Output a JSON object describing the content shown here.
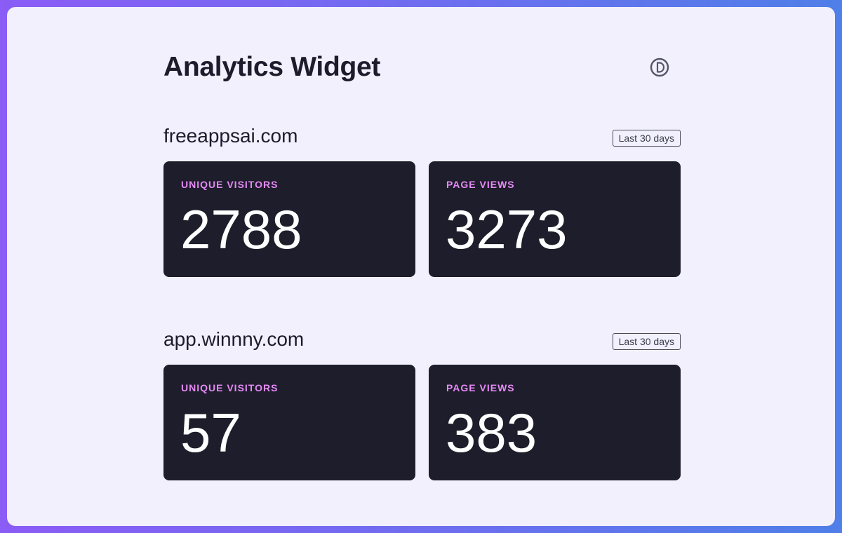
{
  "header": {
    "title": "Analytics Widget",
    "theme_toggle_icon": "contrast-toggle-icon"
  },
  "sites": [
    {
      "domain": "freeappsai.com",
      "range": "Last 30 days",
      "metrics": [
        {
          "label": "UNIQUE VISITORS",
          "value": "2788"
        },
        {
          "label": "PAGE VIEWS",
          "value": "3273"
        }
      ]
    },
    {
      "domain": "app.winnny.com",
      "range": "Last 30 days",
      "metrics": [
        {
          "label": "UNIQUE VISITORS",
          "value": "57"
        },
        {
          "label": "PAGE VIEWS",
          "value": "383"
        }
      ]
    }
  ],
  "colors": {
    "background_gradient_start": "#8b5cf6",
    "background_gradient_end": "#4f7fe8",
    "panel": "#f1f0fc",
    "card": "#1e1d2b",
    "metric_label": "#e58af6",
    "metric_value": "#ffffff",
    "text_primary": "#1d1b2c"
  }
}
